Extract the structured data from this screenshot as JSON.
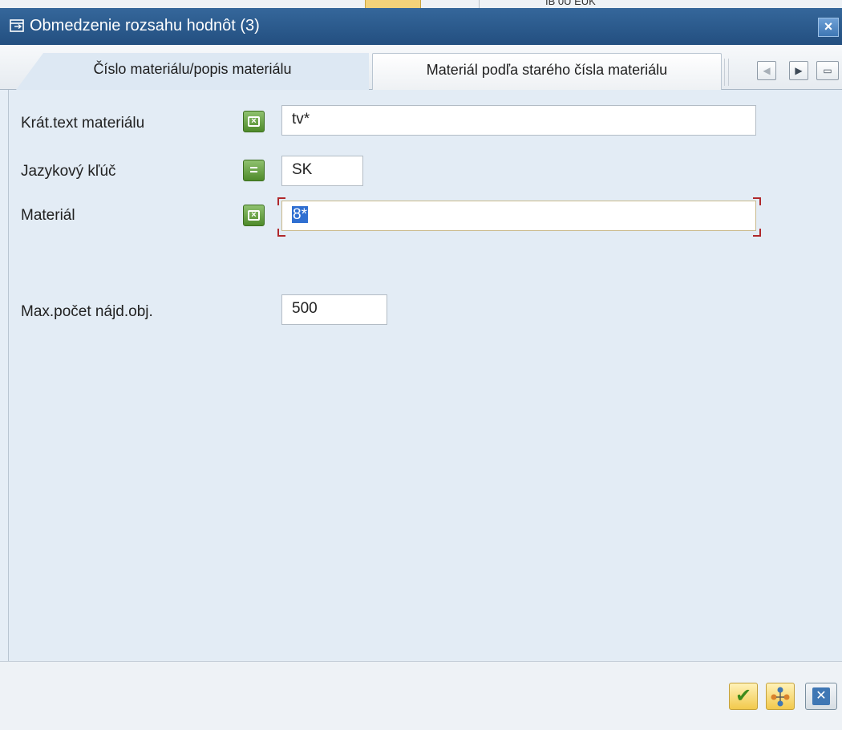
{
  "background": {
    "partial_text": "IB 0U  EUK"
  },
  "window": {
    "title": "Obmedzenie rozsahu hodnôt (3)",
    "close_label": "×"
  },
  "tabs": [
    {
      "label": "Číslo materiálu/popis materiálu",
      "active": true
    },
    {
      "label": "Materiál podľa starého čísla materiálu",
      "active": false
    }
  ],
  "tab_nav": {
    "prev": "◀",
    "next": "▶",
    "list": "▭"
  },
  "fields": {
    "short_text": {
      "label": "Krát.text materiálu",
      "operator": "×",
      "value": "tv*"
    },
    "language": {
      "label": "Jazykový kľúč",
      "operator": "=",
      "value": "SK"
    },
    "material": {
      "label": "Materiál",
      "operator": "×",
      "value": "8*"
    },
    "max_hits": {
      "label": "Max.počet nájd.obj.",
      "value": "500"
    }
  },
  "footer": {
    "ok": "✔",
    "cancel": "✕"
  },
  "colors": {
    "title_bar": "#2a5a8c",
    "operator_green": "#4e8a2a",
    "accent_yellow": "#f2c94c",
    "selection_blue": "#2f6fd1"
  },
  "icons": [
    "window-icon",
    "close-icon",
    "tab-prev-icon",
    "tab-next-icon",
    "tab-list-icon",
    "select-option-icon",
    "equal-option-icon",
    "checkmark-icon",
    "hierarchy-icon",
    "cancel-icon"
  ]
}
